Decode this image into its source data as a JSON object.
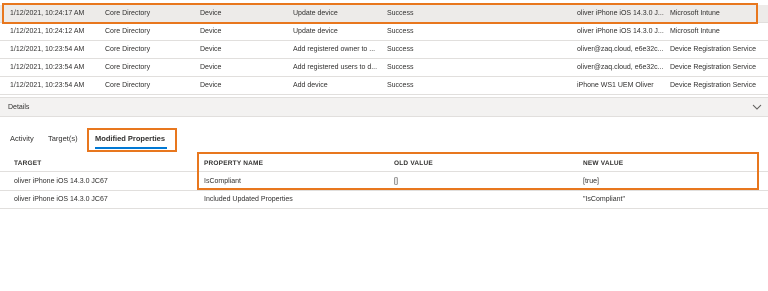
{
  "audit_rows": [
    {
      "date": "1/12/2021, 10:24:17 AM",
      "service": "Core Directory",
      "category": "Device",
      "activity": "Update device",
      "result": "Success",
      "target": "oliver iPhone iOS 14.3.0 J...",
      "initiated_by": "Microsoft Intune"
    },
    {
      "date": "1/12/2021, 10:24:12 AM",
      "service": "Core Directory",
      "category": "Device",
      "activity": "Update device",
      "result": "Success",
      "target": "oliver iPhone iOS 14.3.0 J...",
      "initiated_by": "Microsoft Intune"
    },
    {
      "date": "1/12/2021, 10:23:54 AM",
      "service": "Core Directory",
      "category": "Device",
      "activity": "Add registered owner to ...",
      "result": "Success",
      "target": "oliver@zaq.cloud, e6e32c...",
      "initiated_by": "Device Registration Service"
    },
    {
      "date": "1/12/2021, 10:23:54 AM",
      "service": "Core Directory",
      "category": "Device",
      "activity": "Add registered users to d...",
      "result": "Success",
      "target": "oliver@zaq.cloud, e6e32c...",
      "initiated_by": "Device Registration Service"
    },
    {
      "date": "1/12/2021, 10:23:54 AM",
      "service": "Core Directory",
      "category": "Device",
      "activity": "Add device",
      "result": "Success",
      "target": "iPhone WS1 UEM Oliver",
      "initiated_by": "Device Registration Service"
    }
  ],
  "details": {
    "label": "Details",
    "chevron_icon": "chevron-down-icon"
  },
  "tabs": {
    "activity": "Activity",
    "targets": "Target(s)",
    "modified": "Modified Properties"
  },
  "props": {
    "headers": {
      "target": "TARGET",
      "property_name": "PROPERTY NAME",
      "old_value": "OLD VALUE",
      "new_value": "NEW VALUE"
    },
    "rows": [
      {
        "target": "oliver iPhone iOS 14.3.0 JC67",
        "property_name": "IsCompliant",
        "old_value": "[]",
        "new_value": "[true]"
      },
      {
        "target": "oliver iPhone iOS 14.3.0 JC67",
        "property_name": "Included Updated Properties",
        "old_value": "",
        "new_value": "\"IsCompliant\""
      }
    ]
  },
  "colors": {
    "highlight": "#e8771e",
    "selected_row": "#edebe9",
    "tab_accent": "#0078d4"
  }
}
